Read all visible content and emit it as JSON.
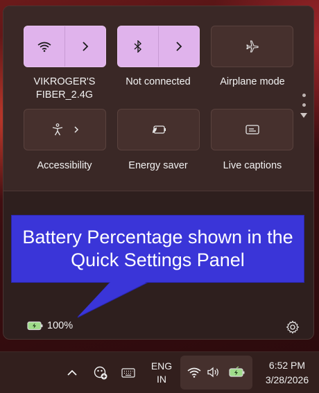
{
  "quick_settings": {
    "tiles": [
      {
        "label": "VIKROGER'S FIBER_2.4G",
        "icon": "wifi-icon",
        "state": "on",
        "has_chevron": true
      },
      {
        "label": "Not connected",
        "icon": "bluetooth-icon",
        "state": "on",
        "has_chevron": true
      },
      {
        "label": "Airplane mode",
        "icon": "airplane-icon",
        "state": "off",
        "has_chevron": false
      },
      {
        "label": "Accessibility",
        "icon": "accessibility-icon",
        "state": "off",
        "has_chevron": true
      },
      {
        "label": "Energy saver",
        "icon": "energy-saver-icon",
        "state": "off",
        "has_chevron": false
      },
      {
        "label": "Live captions",
        "icon": "live-captions-icon",
        "state": "off",
        "has_chevron": false
      }
    ],
    "battery_percent": "100%",
    "settings_icon": "gear-icon"
  },
  "callout": {
    "text": "Battery Percentage shown in the Quick Settings Panel",
    "color": "#3a35d8"
  },
  "taskbar": {
    "language_line1": "ENG",
    "language_line2": "IN",
    "time": "6:52 PM",
    "date": "3/28/2026",
    "icons": [
      "chevron-up-icon",
      "copilot-icon",
      "keyboard-icon",
      "wifi-icon",
      "volume-icon",
      "battery-icon"
    ]
  },
  "colors": {
    "accent_tile": "#e0b3ec",
    "battery_fill": "#9fdc8a"
  }
}
